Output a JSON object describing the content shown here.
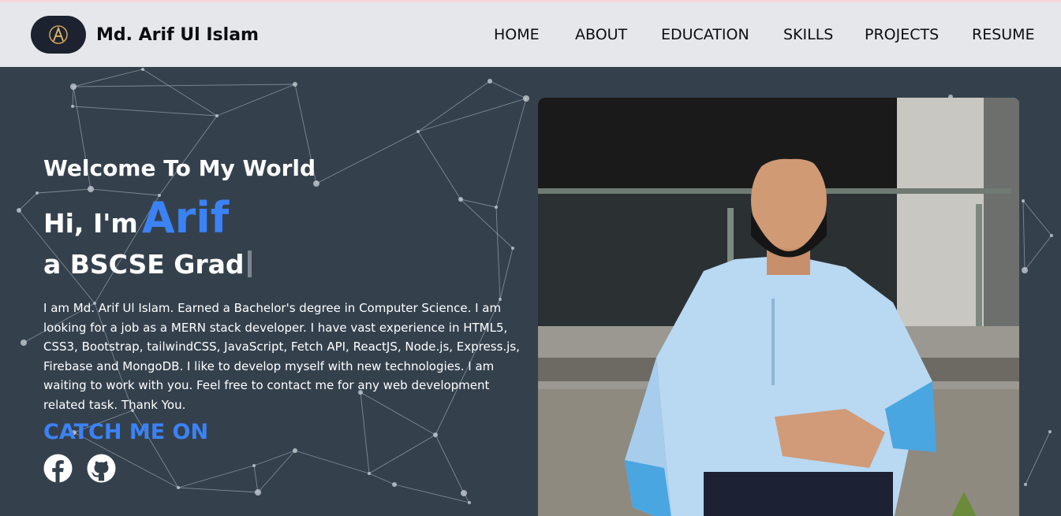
{
  "header": {
    "brand_name": "Md. Arif Ul Islam",
    "nav": [
      "HOME",
      "ABOUT",
      "EDUCATION",
      "SKILLS",
      "PROJECTS",
      "RESUME"
    ]
  },
  "hero": {
    "welcome": "Welcome To My World",
    "greeting_prefix": "Hi, I'm",
    "name": "Arif",
    "role_text": "a BSCSE Grad",
    "bio": "I am Md. Arif Ul Islam. Earned a Bachelor's degree in Computer Science. I am looking for a job as a MERN stack developer. I have vast experience in HTML5, CSS3, Bootstrap, tailwindCSS, JavaScript, Fetch API, ReactJS, Node.js, Express.js, Firebase and MongoDB. I like to develop myself with new technologies. I am waiting to work with you. Feel free to contact me for any web development related task. Thank You.",
    "catch_heading": "CATCH ME ON",
    "social_icons": [
      "facebook-icon",
      "github-icon"
    ]
  },
  "colors": {
    "accent": "#3b82f6",
    "hero_bg": "#34414d",
    "navbar_bg": "#e6e7ea",
    "logo_bg": "#1c2230"
  }
}
